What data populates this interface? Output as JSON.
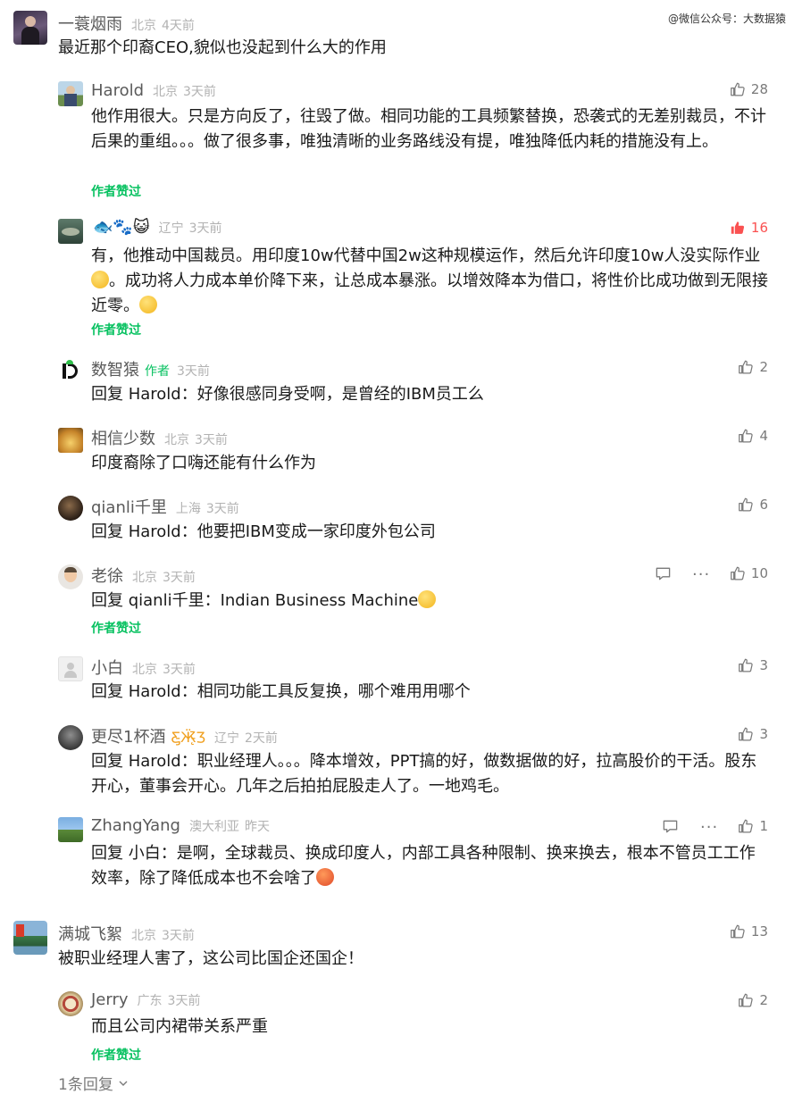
{
  "watermark": "@微信公众号：大数据猿",
  "c1": {
    "nick": "一蓑烟雨",
    "loc": "北京",
    "time": "4天前",
    "text": "最近那个印裔CEO,貌似也没起到什么大的作用"
  },
  "r1": {
    "nick": "Harold",
    "loc": "北京",
    "time": "3天前",
    "likes": "28",
    "text": "他作用很大。只是方向反了，往毁了做。相同功能的工具频繁替换，恐袭式的无差别裁员，不计后果的重组。。。做了很多事，唯独清晰的业务路线没有提，唯独降低内耗的措施没有上。",
    "praised": "作者赞过"
  },
  "r2": {
    "nick": "🐟🐾😺",
    "loc": "辽宁",
    "time": "3天前",
    "likes": "16",
    "text1": "有，他推动中国裁员。用印度10w代替中国2w这种规模运作，然后允许印度10w人没实际作业",
    "text2": "。成功将人力成本单价降下来，让总成本暴涨。以增效降本为借口，将性价比成功做到无限接近零。",
    "praised": "作者赞过"
  },
  "r3": {
    "nick": "数智猿",
    "tag": "作者",
    "time": "3天前",
    "likes": "2",
    "prefix": "回复 Harold：",
    "text": "好像很感同身受啊，是曾经的IBM员工么"
  },
  "r4": {
    "nick": "相信少数",
    "loc": "北京",
    "time": "3天前",
    "likes": "4",
    "text": "印度裔除了口嗨还能有什么作为"
  },
  "r5": {
    "nick": "qianli千里",
    "loc": "上海",
    "time": "3天前",
    "likes": "6",
    "prefix": "回复 Harold：",
    "text": "他要把IBM变成一家印度外包公司"
  },
  "r6": {
    "nick": "老徐",
    "loc": "北京",
    "time": "3天前",
    "likes": "10",
    "prefix": "回复 qianli千里：",
    "text": "Indian Business Machine",
    "praised": "作者赞过"
  },
  "r7": {
    "nick": "小白",
    "loc": "北京",
    "time": "3天前",
    "likes": "3",
    "prefix": "回复 Harold：",
    "text": "相同功能工具反复换，哪个难用用哪个"
  },
  "r8": {
    "nick": "更尽1杯酒",
    "loc": "辽宁",
    "time": "2天前",
    "likes": "3",
    "prefix": "回复 Harold：",
    "text": "职业经理人。。。降本增效，PPT搞的好，做数据做的好，拉高股价的干活。股东开心，董事会开心。几年之后拍拍屁股走人了。一地鸡毛。"
  },
  "r9": {
    "nick": "ZhangYang",
    "loc": "澳大利亚",
    "time": "昨天",
    "likes": "1",
    "prefix": "回复 小白：",
    "text": "是啊，全球裁员、换成印度人，内部工具各种限制、换来换去，根本不管员工工作效率，除了降低成本也不会啥了"
  },
  "c2": {
    "nick": "满城飞絮",
    "loc": "北京",
    "time": "3天前",
    "likes": "13",
    "text": "被职业经理人害了，这公司比国企还国企！"
  },
  "r10": {
    "nick": "Jerry",
    "loc": "广东",
    "time": "3天前",
    "likes": "2",
    "text": "而且公司内裙带关系严重",
    "praised": "作者赞过"
  },
  "more_replies": "1条回复",
  "colors": {
    "accent": "#07c160",
    "hot": "#fa5151",
    "meta": "#b2b2b2"
  }
}
